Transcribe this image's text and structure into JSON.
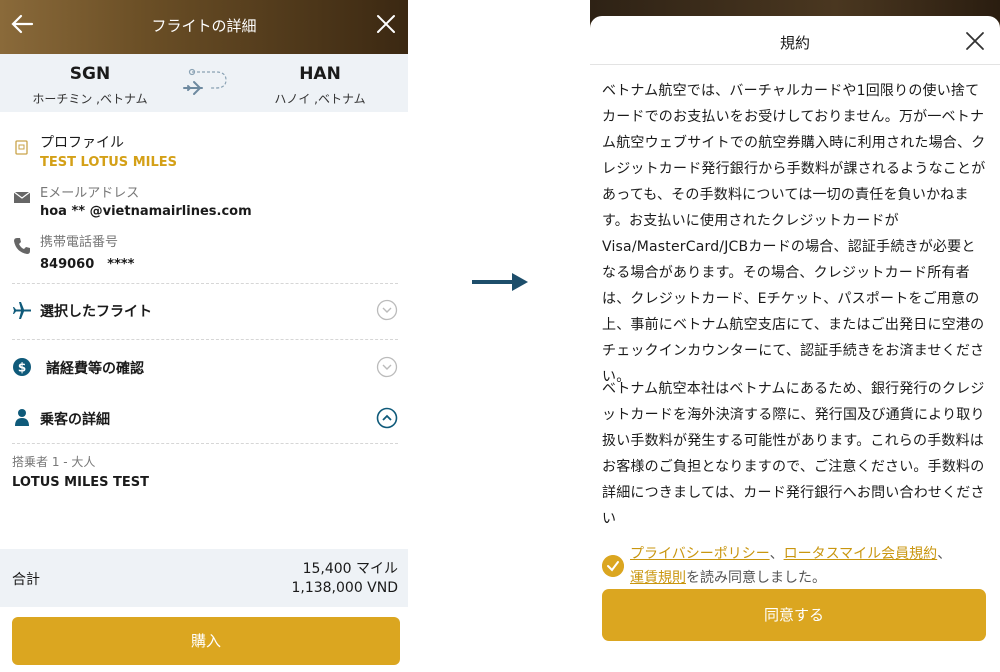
{
  "left": {
    "header": {
      "title": "フライトの詳細"
    },
    "route": {
      "from_code": "SGN",
      "from_city": "ホーチミン ,ベトナム",
      "to_code": "HAN",
      "to_city": "ハノイ ,ベトナム"
    },
    "profile": {
      "label": "プロファイル",
      "name": "TEST LOTUS MILES",
      "email_label": "Eメールアドレス",
      "email_value": "hoa ** @vietnamairlines.com",
      "phone_label": "携帯電話番号",
      "phone_value": "849060　****"
    },
    "sections": {
      "selected_flight": "選択したフライト",
      "fees": "諸経費等の確認",
      "passenger": "乗客の詳細"
    },
    "passenger": {
      "type": "搭乗者 1 - 大人",
      "name": "LOTUS MILES TEST"
    },
    "total": {
      "label": "合計",
      "miles": "15,400 マイル",
      "vnd": "1,138,000 VND"
    },
    "buy_label": "購入"
  },
  "right": {
    "title": "規約",
    "paragraph1": "ベトナム航空では、バーチャルカードや1回限りの使い捨てカードでのお支払いをお受けしておりません。万が一ベトナム航空ウェブサイトでの航空券購入時に利用された場合、クレジットカード発行銀行から手数料が課されるようなことがあっても、その手数料については一切の責任を負いかねます。お支払いに使用されたクレジットカードがVisa/MasterCard/JCBカードの場合、認証手続きが必要となる場合があります。その場合、クレジットカード所有者は、クレジットカード、Eチケット、パスポートをご用意の上、事前にベトナム航空支店にて、またはご出発日に空港のチェックインカウンターにて、認証手続きをお済ませください。",
    "paragraph2": "ベトナム航空本社はベトナムにあるため、銀行発行のクレジットカードを海外決済する際に、発行国及び通貨により取り扱い手数料が発生する可能性があります。これらの手数料はお客様のご負担となりますので、ご注意ください。手数料の詳細につきましては、カード発行銀行へお問い合わせください",
    "agree": {
      "link_privacy": "プライバシーポリシー",
      "sep1": "、",
      "link_lotus": "ロータスマイル会員規約",
      "sep2": "、",
      "link_fare": "運賃規則",
      "suffix": "を読み同意しました。"
    },
    "ok_label": "同意する"
  },
  "colors": {
    "gold": "#dba620",
    "teal": "#0f5a7a",
    "header_brown": "#6b4f26"
  },
  "icons": [
    "back-arrow-icon",
    "close-icon",
    "plane-route-icon",
    "id-card-icon",
    "mail-icon",
    "phone-icon",
    "plane-icon",
    "dollar-icon",
    "person-icon",
    "chevron-down-icon",
    "chevron-up-icon",
    "arrow-right-icon",
    "check-icon"
  ]
}
